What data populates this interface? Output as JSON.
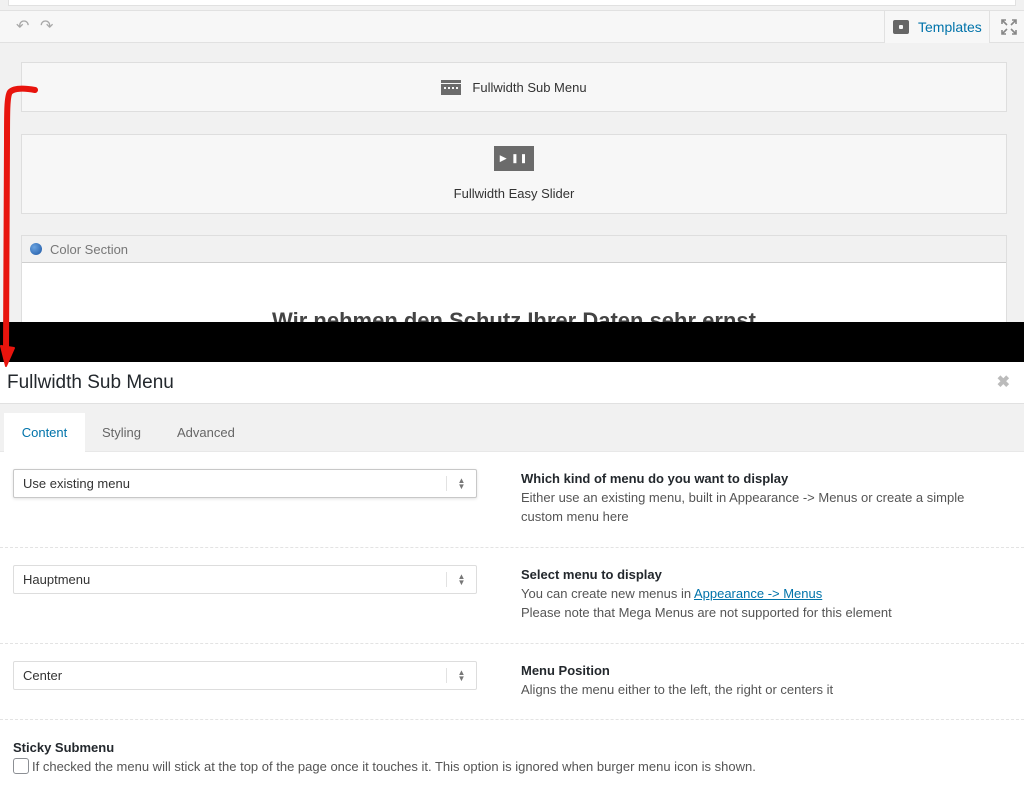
{
  "toolbar": {
    "templates_label": "Templates"
  },
  "builder": {
    "submenu_label": "Fullwidth Sub Menu",
    "slider_icon_text": "▶ ❚❚",
    "slider_label": "Fullwidth Easy Slider",
    "color_section_label": "Color Section",
    "color_section_heading": "Wir nehmen den Schutz Ihrer Daten sehr ernst"
  },
  "modal": {
    "title": "Fullwidth Sub Menu",
    "close": "✖",
    "tabs": [
      {
        "label": "Content"
      },
      {
        "label": "Styling"
      },
      {
        "label": "Advanced"
      }
    ],
    "options": [
      {
        "value": "Use existing menu",
        "title": "Which kind of menu do you want to display",
        "text": "Either use an existing menu, built in Appearance -> Menus or create a simple custom menu here"
      },
      {
        "value": "Hauptmenu",
        "title": "Select menu to display",
        "text_before": "You can create new menus in ",
        "link": "Appearance -> Menus",
        "text_after": "Please note that Mega Menus are not supported for this element"
      },
      {
        "value": "Center",
        "title": "Menu Position",
        "text": "Aligns the menu either to the left, the right or centers it"
      }
    ],
    "sticky": {
      "title": "Sticky Submenu",
      "text": "If checked the menu will stick at the top of the page once it touches it. This option is ignored when burger menu icon is shown."
    }
  },
  "colors": {
    "link": "#0073aa",
    "arrow": "#e8140d",
    "color_section_dot": "#1d57a4"
  }
}
